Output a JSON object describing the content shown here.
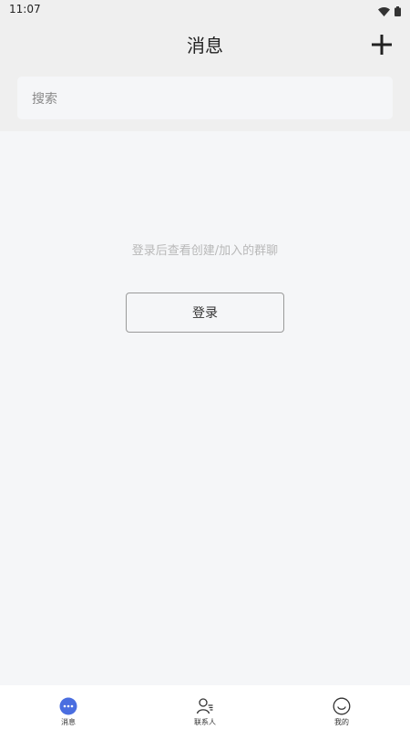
{
  "status_bar": {
    "time": "11:07"
  },
  "header": {
    "title": "消息",
    "add_icon": "plus-icon"
  },
  "search": {
    "placeholder": "搜索"
  },
  "empty_state": {
    "hint": "登录后查看创建/加入的群聊",
    "login_label": "登录"
  },
  "bottom_nav": {
    "items": [
      {
        "label": "消息",
        "icon": "chat-bubble-icon",
        "active": true
      },
      {
        "label": "联系人",
        "icon": "contacts-icon",
        "active": false
      },
      {
        "label": "我的",
        "icon": "smiley-icon",
        "active": false
      }
    ]
  },
  "colors": {
    "accent": "#4a6ee0",
    "header_bg": "#efefef",
    "page_bg": "#f5f6f8"
  }
}
